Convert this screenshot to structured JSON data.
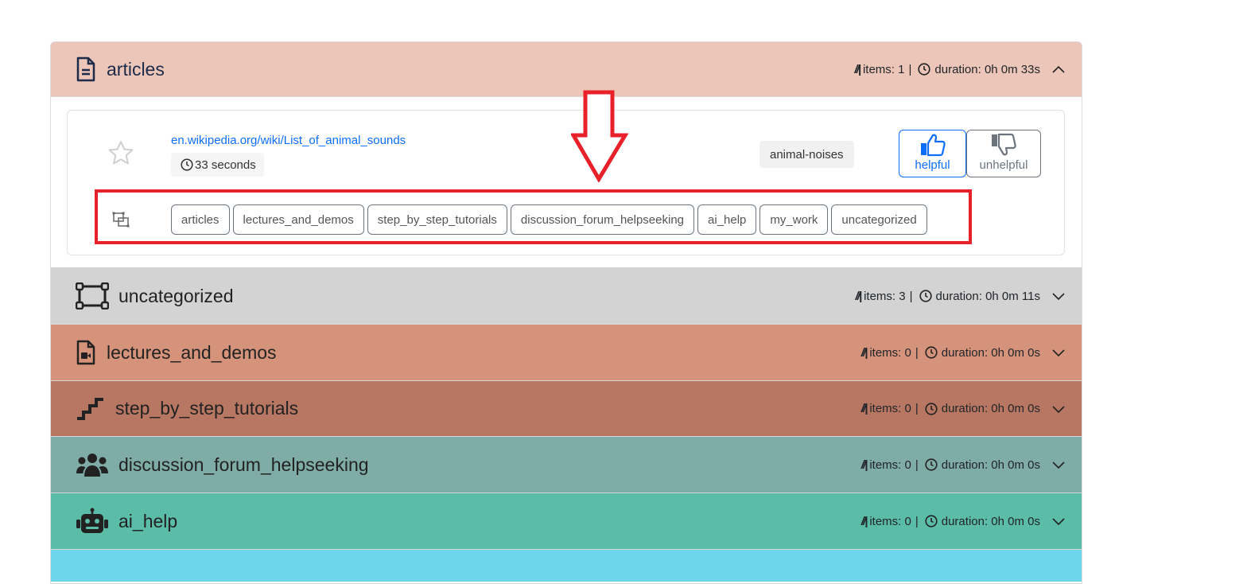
{
  "labels": {
    "items_prefix": "items:",
    "duration_prefix": "duration:",
    "separator": "|"
  },
  "categories": [
    {
      "name": "articles",
      "items": "1",
      "duration": "0h 0m 33s",
      "color": "#ecc6b9",
      "expanded": true,
      "icon": "file-text-icon"
    },
    {
      "name": "uncategorized",
      "items": "3",
      "duration": "0h 0m 11s",
      "color": "#d3d3d3",
      "expanded": false,
      "icon": "bounding-box-icon"
    },
    {
      "name": "lectures_and_demos",
      "items": "0",
      "duration": "0h 0m 0s",
      "color": "#d6937b",
      "expanded": false,
      "icon": "file-video-icon"
    },
    {
      "name": "step_by_step_tutorials",
      "items": "0",
      "duration": "0h 0m 0s",
      "color": "#b87762",
      "expanded": false,
      "icon": "stairs-icon"
    },
    {
      "name": "discussion_forum_helpseeking",
      "items": "0",
      "duration": "0h 0m 0s",
      "color": "#7faca6",
      "expanded": false,
      "icon": "people-icon"
    },
    {
      "name": "ai_help",
      "items": "0",
      "duration": "0h 0m 0s",
      "color": "#5bbca8",
      "expanded": false,
      "icon": "robot-icon"
    },
    {
      "color": "#6dd6ea"
    }
  ],
  "article_entry": {
    "url": "en.wikipedia.org/wiki/List_of_animal_sounds",
    "duration": "33 seconds",
    "tag": "animal-noises",
    "helpful_label": "helpful",
    "unhelpful_label": "unhelpful",
    "move_to": [
      "articles",
      "lectures_and_demos",
      "step_by_step_tutorials",
      "discussion_forum_helpseeking",
      "ai_help",
      "my_work",
      "uncategorized"
    ]
  },
  "annotation": {
    "color": "#e8202a"
  }
}
